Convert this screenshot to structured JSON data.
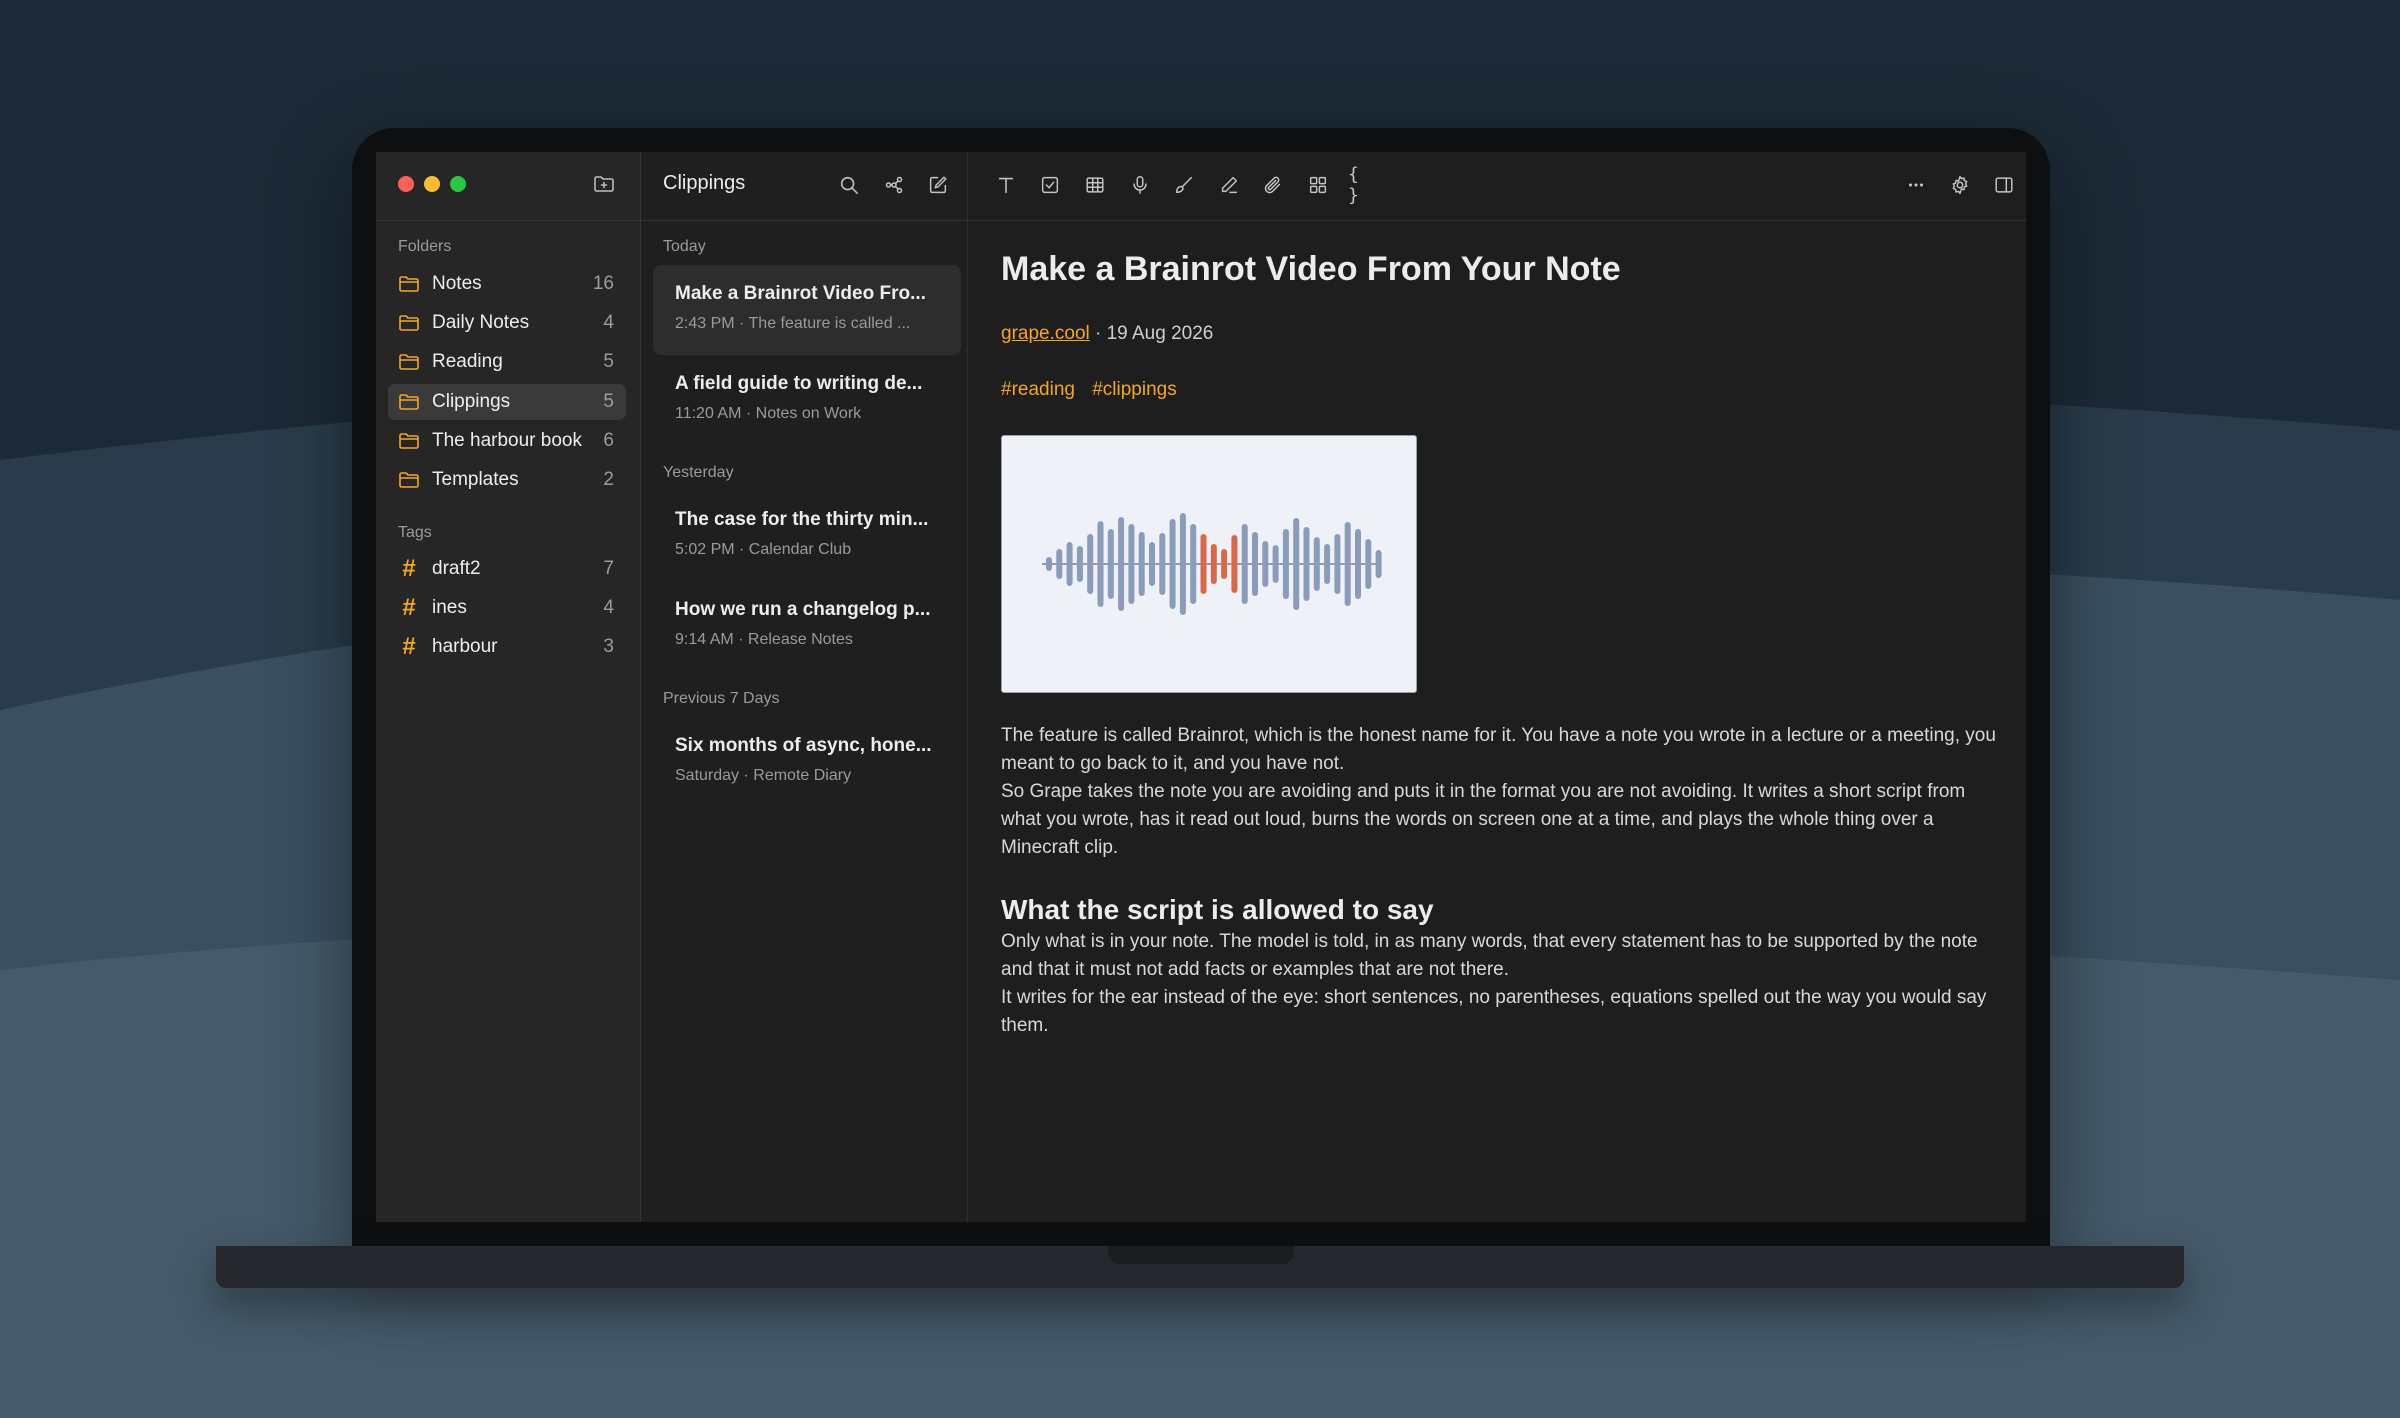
{
  "window": {
    "folder_title": "Clippings"
  },
  "sidebar": {
    "folders_label": "Folders",
    "folders": [
      {
        "label": "Notes",
        "count": "16",
        "active": false
      },
      {
        "label": "Daily Notes",
        "count": "4",
        "active": false
      },
      {
        "label": "Reading",
        "count": "5",
        "active": false
      },
      {
        "label": "Clippings",
        "count": "5",
        "active": true
      },
      {
        "label": "The harbour book",
        "count": "6",
        "active": false
      },
      {
        "label": "Templates",
        "count": "2",
        "active": false
      }
    ],
    "tags_label": "Tags",
    "tags": [
      {
        "label": "draft2",
        "count": "7"
      },
      {
        "label": "ines",
        "count": "4"
      },
      {
        "label": "harbour",
        "count": "3"
      }
    ],
    "accent_color": "#f5a623"
  },
  "note_list": {
    "groups": [
      {
        "label": "Today"
      },
      {
        "label": "Yesterday"
      },
      {
        "label": "Previous 7 Days"
      }
    ],
    "notes": [
      {
        "title": "Make a Brainrot Video Fro...",
        "meta": "2:43 PM · The feature is called ...",
        "active": true
      },
      {
        "title": "A field guide to writing de...",
        "meta": "11:20 AM · Notes on Work",
        "active": false
      },
      {
        "title": "The case for the thirty min...",
        "meta": "5:02 PM · Calendar Club",
        "active": false
      },
      {
        "title": "How we run a changelog p...",
        "meta": "9:14 AM · Release Notes",
        "active": false
      },
      {
        "title": "Six months of async, hone...",
        "meta": "Saturday · Remote Diary",
        "active": false
      }
    ]
  },
  "toolbar": {
    "icons": [
      "search-icon",
      "link-icon",
      "compose-icon",
      "text-format-icon",
      "checklist-icon",
      "table-icon",
      "microphone-icon",
      "brush-icon",
      "pen-icon",
      "attachment-icon",
      "grid-icon",
      "code-braces-icon",
      "more-icon",
      "settings-icon",
      "sidebar-toggle-icon"
    ],
    "code_glyph": "{ }"
  },
  "document": {
    "title": "Make a Brainrot Video From Your Note",
    "source_link": "grape.cool",
    "date": " · 19 Aug 2026",
    "tags": [
      "#reading",
      "#clippings"
    ],
    "image": {
      "description_icon": "audio-waveform-image",
      "wave_color": "#8a9cba",
      "highlight_color": "#d9684a"
    },
    "paragraphs": [
      "The feature is called Brainrot, which is the honest name for it. You have a note you wrote in a lecture or a meeting, you meant to go back to it, and you have not.",
      "So Grape takes the note you are avoiding and puts it in the format you are not avoiding. It writes a short script from what you wrote, has it read out loud, burns the words on screen one at a time, and plays the whole thing over a Minecraft clip."
    ],
    "heading": "What the script is allowed to say",
    "paragraphs2": [
      "Only what is in your note. The model is told, in as many words, that every statement has to be supported by the note and that it must not add facts or examples that are not there.",
      "It writes for the ear instead of the eye: short sentences, no parentheses, equations spelled out the way you would say them."
    ]
  }
}
